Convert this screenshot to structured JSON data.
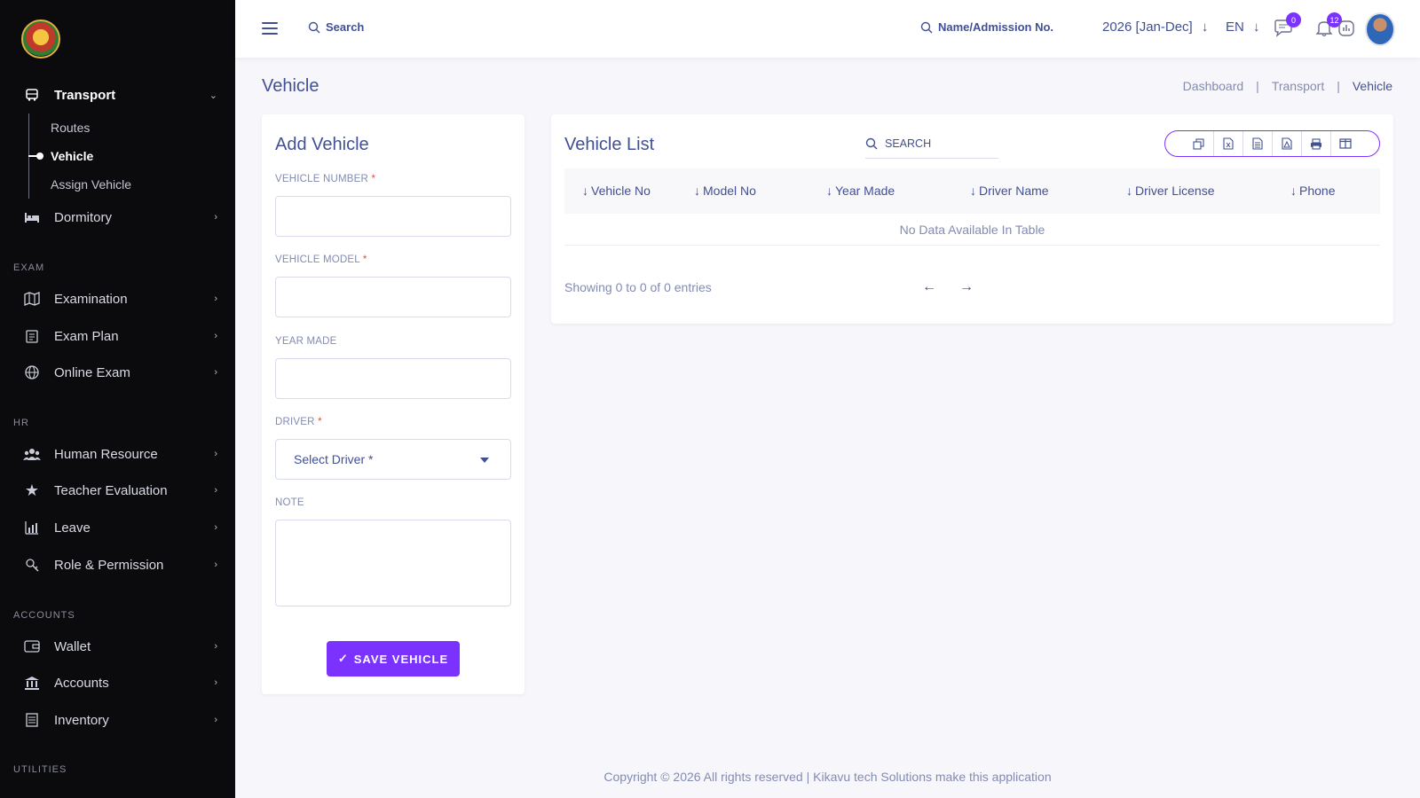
{
  "sidebar": {
    "sections": {
      "exam": "EXAM",
      "hr": "HR",
      "accounts": "ACCOUNTS",
      "utilities": "UTILITIES"
    },
    "items": {
      "transport": "Transport",
      "dormitory": "Dormitory",
      "examination": "Examination",
      "exam_plan": "Exam Plan",
      "online_exam": "Online Exam",
      "human_resource": "Human Resource",
      "teacher_evaluation": "Teacher Evaluation",
      "leave": "Leave",
      "role_permission": "Role & Permission",
      "wallet": "Wallet",
      "accounts": "Accounts",
      "inventory": "Inventory"
    },
    "transport_sub": {
      "routes": "Routes",
      "vehicle": "Vehicle",
      "assign_vehicle": "Assign Vehicle"
    }
  },
  "topbar": {
    "search_label": "Search",
    "student_search_label": "Name/Admission No.",
    "session": "2026 [Jan-Dec]",
    "language": "EN",
    "messages_count": "0",
    "notifications_count": "12"
  },
  "page": {
    "title": "Vehicle",
    "breadcrumb": {
      "dashboard": "Dashboard",
      "transport": "Transport",
      "current": "Vehicle"
    }
  },
  "add_form": {
    "title": "Add Vehicle",
    "vehicle_number_label": "VEHICLE NUMBER",
    "vehicle_model_label": "VEHICLE MODEL",
    "year_made_label": "YEAR MADE",
    "driver_label": "DRIVER",
    "driver_placeholder": "Select Driver *",
    "note_label": "NOTE",
    "required_mark": "*",
    "save_label": "SAVE VEHICLE"
  },
  "list": {
    "title": "Vehicle List",
    "search_label": "SEARCH",
    "columns": [
      "Vehicle No",
      "Model No",
      "Year Made",
      "Driver Name",
      "Driver License",
      "Phone"
    ],
    "empty_text": "No Data Available In Table",
    "showing_text": "Showing 0 to 0 of 0 entries"
  },
  "footer": {
    "text": "Copyright © 2026 All rights reserved | Kikavu tech Solutions make this application"
  },
  "colors": {
    "accent": "#7c32ff",
    "text": "#415094",
    "muted": "#828bb2",
    "sidebar_bg": "#0b0b0e"
  }
}
